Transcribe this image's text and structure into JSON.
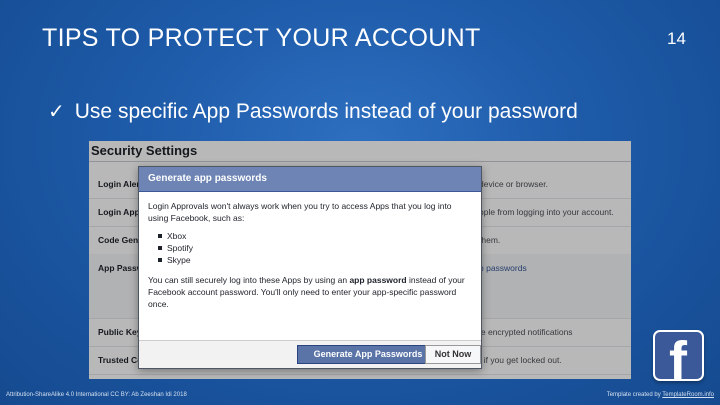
{
  "slide": {
    "title": "TIPS TO PROTECT YOUR ACCOUNT",
    "number": "14",
    "bullet_icon": "check-icon",
    "bullet_text": "Use specific App Passwords instead of your password"
  },
  "settings": {
    "title": "Security Settings",
    "rows": [
      {
        "label": "Login Alerts",
        "desc": "device or browser."
      },
      {
        "label": "Login Approvals",
        "desc": "ople from logging into your account."
      },
      {
        "label": "Code Generator",
        "desc": "them."
      },
      {
        "label": "App Passwords",
        "desc": "p passwords"
      },
      {
        "label": "Public Key",
        "desc": "le encrypted notifications"
      },
      {
        "label": "Trusted Contacts",
        "desc": "t if you get locked out."
      }
    ]
  },
  "dialog": {
    "title": "Generate app passwords",
    "para1": "Login Approvals won't always work when you try to access Apps that you log into using Facebook, such as:",
    "apps": [
      "Xbox",
      "Spotify",
      "Skype"
    ],
    "para2_pre": "You can still securely log into these Apps by using an ",
    "para2_bold": "app password",
    "para2_post": " instead of your Facebook account password. You'll only need to enter your app-specific password once.",
    "primary_button": "Generate App Passwords",
    "secondary_button": "Not Now"
  },
  "logo": {
    "icon": "facebook-icon",
    "glyph": "f",
    "color": "#3b5998"
  },
  "footer": {
    "left": "Attribution-ShareAlike 4.0 International CC BY: Ab Zeeshan Idi 2018",
    "right_prefix": "Template created by ",
    "right_link": "TemplateRoom.info"
  }
}
